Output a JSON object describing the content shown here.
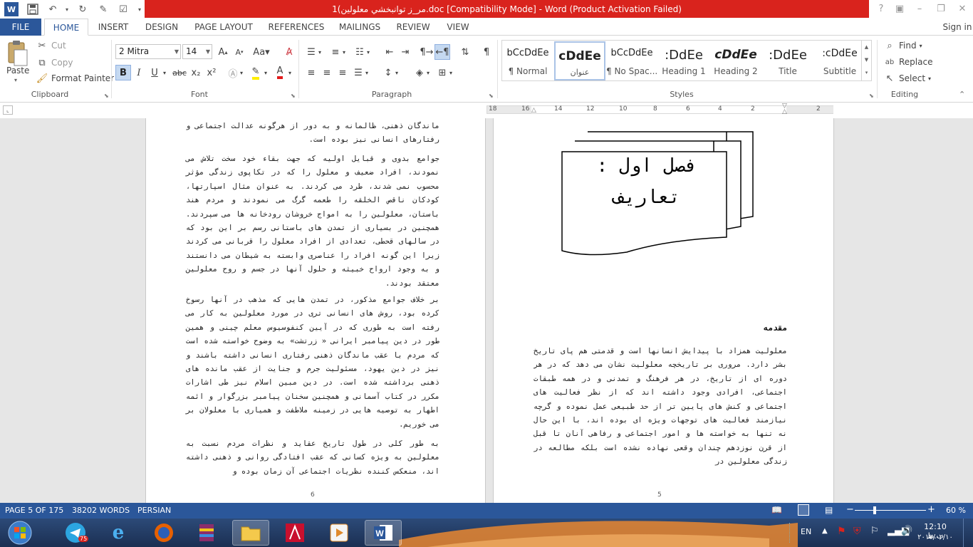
{
  "app": {
    "title": "مر_ز توانبخشي معلولين)1.doc [Compatibility Mode] -  Word (Product Activation Failed)",
    "sign_in": "Sign in"
  },
  "tabs": [
    "FILE",
    "HOME",
    "INSERT",
    "DESIGN",
    "PAGE LAYOUT",
    "REFERENCES",
    "MAILINGS",
    "REVIEW",
    "VIEW"
  ],
  "clipboard": {
    "paste": "Paste",
    "cut": "Cut",
    "copy": "Copy",
    "format_painter": "Format Painter",
    "label": "Clipboard"
  },
  "font": {
    "name": "2  Mitra",
    "size": "14",
    "label": "Font",
    "bold": "B",
    "italic": "I",
    "underline": "U",
    "strike": "abc",
    "sub": "x₂",
    "sup": "x²"
  },
  "paragraph": {
    "label": "Paragraph"
  },
  "styles": {
    "label": "Styles",
    "items": [
      {
        "preview": "bCcDdEe",
        "name": "¶ Normal"
      },
      {
        "preview": "cDdEe",
        "name": "عنوان"
      },
      {
        "preview": "bCcDdEe",
        "name": "¶ No Spac..."
      },
      {
        "preview": ":DdEe",
        "name": "Heading 1"
      },
      {
        "preview": "cDdEe",
        "name": "Heading 2"
      },
      {
        "preview": ":DdEe",
        "name": "Title"
      },
      {
        "preview": ":cDdEe",
        "name": "Subtitle"
      }
    ]
  },
  "editing": {
    "find": "Find",
    "replace": "Replace",
    "select": "Select",
    "label": "Editing"
  },
  "ruler": {
    "numbers": [
      "18",
      "16",
      "14",
      "12",
      "10",
      "8",
      "6",
      "4",
      "2",
      "2"
    ]
  },
  "left_page": {
    "paragraphs": [
      "ماندگان ذهنی، ظالمانه و به دور از هرگونه عدالت اجتماعی و رفتارهای انسانی نیز بوده است.",
      "جوامع بدوی و قبایل اولیه که جهت بقاء خود سخت تلاش می نمودند، افراد ضعیف و معلول را که در تکاپوی زندگی مؤثر محسوب نمی شدند، طرد می کردند. به عنوان مثال اسپارتها، کودکان ناقص الخلقه را طعمه گرگ می نمودند و مردم هند باستان، معلولین را به امواج خروشان رودخانه ها می سپردند. همچنین در بسیاری از تمدن های باستانی رسم بر این بود که در سالهای قحطی، تعدادی از افراد معلول را قربانی می کردند زیرا این گونه افراد را عناصری وابسته به شیطان می دانستند و به وجود ارواح خبیثه و حلول آنها در جسم و روح معلولین معتقد بودند.",
      "بر خلاف جوامع مذکور، در تمدن هایی که مذهب در آنها رسوخ کرده بود، روش های انسانی تری در مورد معلولین به کار می رفته است به طوری که در آیین کنفوسیوس معلم چینی و همین طور در دین پیامبر ایرانی « زرتشت» به وضوح خواسته شده است که مردم با عقب ماندگان ذهنی رفتاری انسانی داشته باشند و نیز در دین یهود، مسئولیت جرم و جنایت از عقب مانده های ذهنی برداشته شده است. در دین مبین اسلام نیز طی اشارات مکرر در کتاب آسمانی و همچنین سخنان پیامبر بزرگوار و ائمه اطهار به توصیه هایی در زمینه ملاطفت و همیاری با معلولان بر می خوریم.",
      "به طور کلی در طول تاریخ عقاید و نظرات مردم نسبت به معلولین به ویژه کسانی که عقب افتادگی روانی و ذهنی داشته اند، منعکس کننده نظریات اجتماعی آن زمان بوده و"
    ],
    "page_number": "6"
  },
  "right_page": {
    "box_title": "فصل اول :",
    "box_subtitle": "تعاريف",
    "heading": "مقدمه",
    "paragraph": "معلولیت همزاد با پیدایش انسانها است و قدمتی هم پای تاریخ بشر دارد. مروری بر تاریخچه معلولیت نشان می دهد که در هر دوره ای از تاریخ، در هر فرهنگ و تمدنی و در همه طبقات اجتماعی، افرادی وجود داشته اند که از نظر فعالیت های اجتماعی و کنش های پایین تر از حد طبیعی عمل نموده و گرچه نیازمند فعالیت های توجهات ویژه ای بوده اند، با این حال نه تنها به خواسته ها و امور اجتماعی و رفاهی آنان تا قبل از قرن نوزدهم چندان وقعی نهاده نشده است بلکه مطالعه در زندگی معلولین در",
    "page_number": "5"
  },
  "status": {
    "page": "PAGE 5 OF 175",
    "words": "38202 WORDS",
    "language": "PERSIAN",
    "zoom": "60 %",
    "zoom_level": 0.6
  },
  "taskbar": {
    "lang": "EN",
    "time": "12:10 ب.ظ",
    "date": "۲۰۱۷/۰۲/۱۰",
    "telegram_badge": "75"
  },
  "colors": {
    "accent": "#2b579a",
    "title_bar": "#d9231d"
  }
}
